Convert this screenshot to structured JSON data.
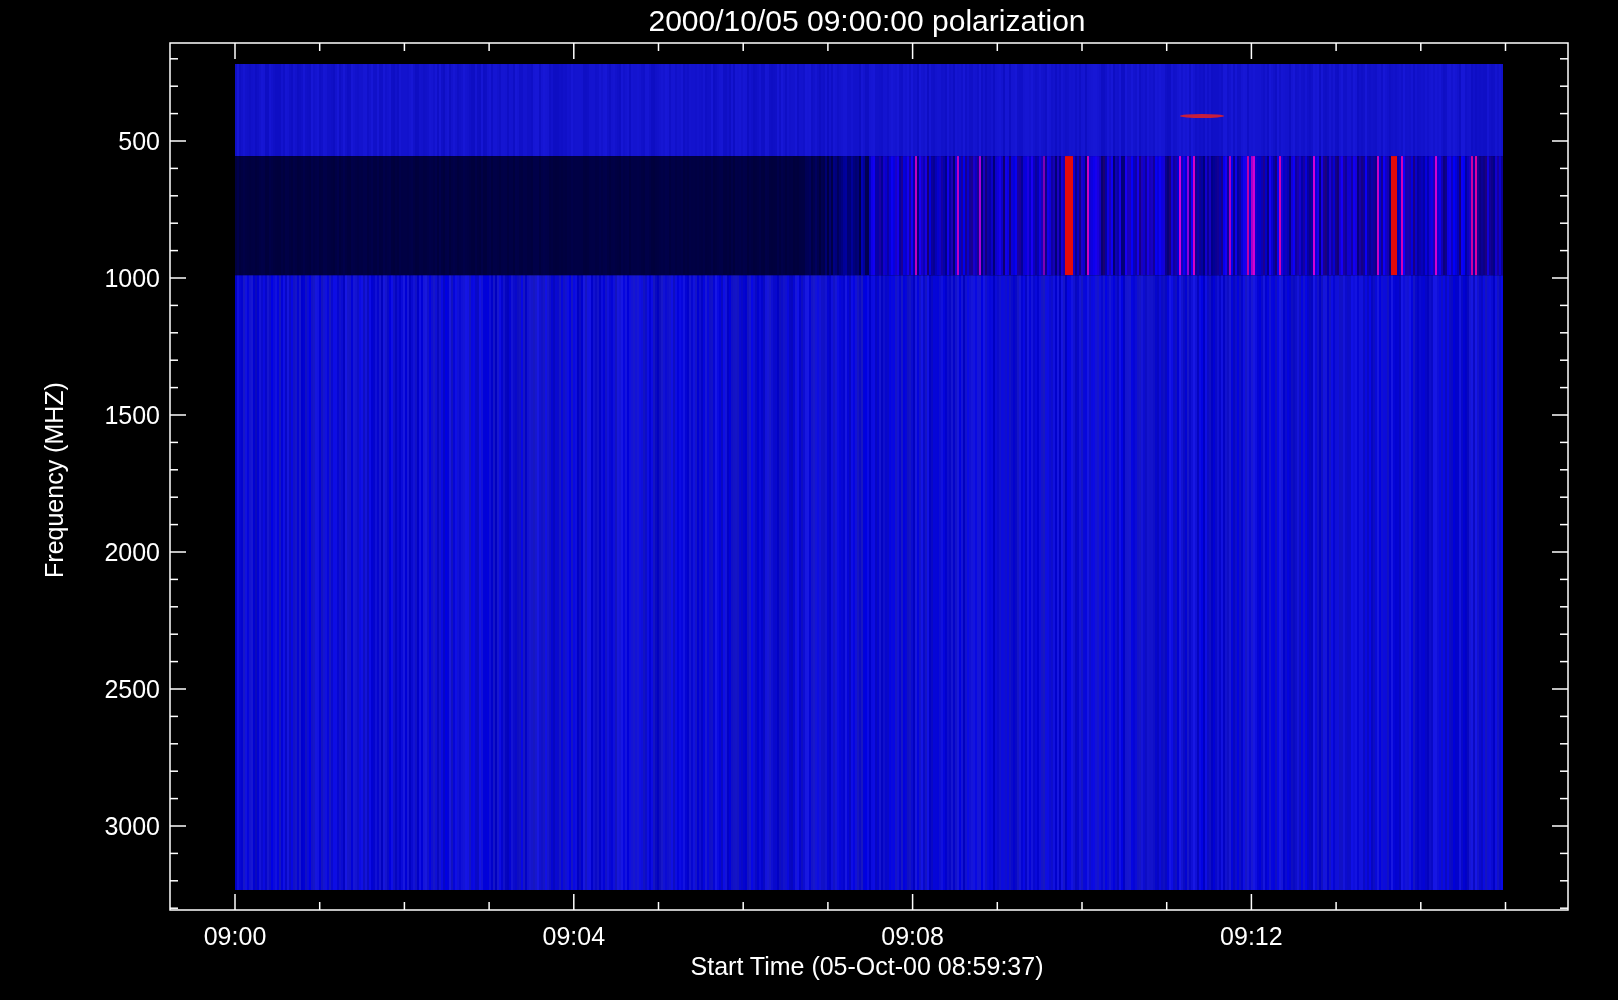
{
  "title": "2000/10/05 09:00:00 polarization",
  "y_axis": {
    "label": "Frequency (MHZ)",
    "tick_labels": [
      "500",
      "1000",
      "1500",
      "2000",
      "2500",
      "3000"
    ]
  },
  "x_axis": {
    "label": "Start Time (05-Oct-00 08:59:37)",
    "tick_labels": [
      "09:00",
      "09:04",
      "09:08",
      "09:12"
    ]
  }
}
